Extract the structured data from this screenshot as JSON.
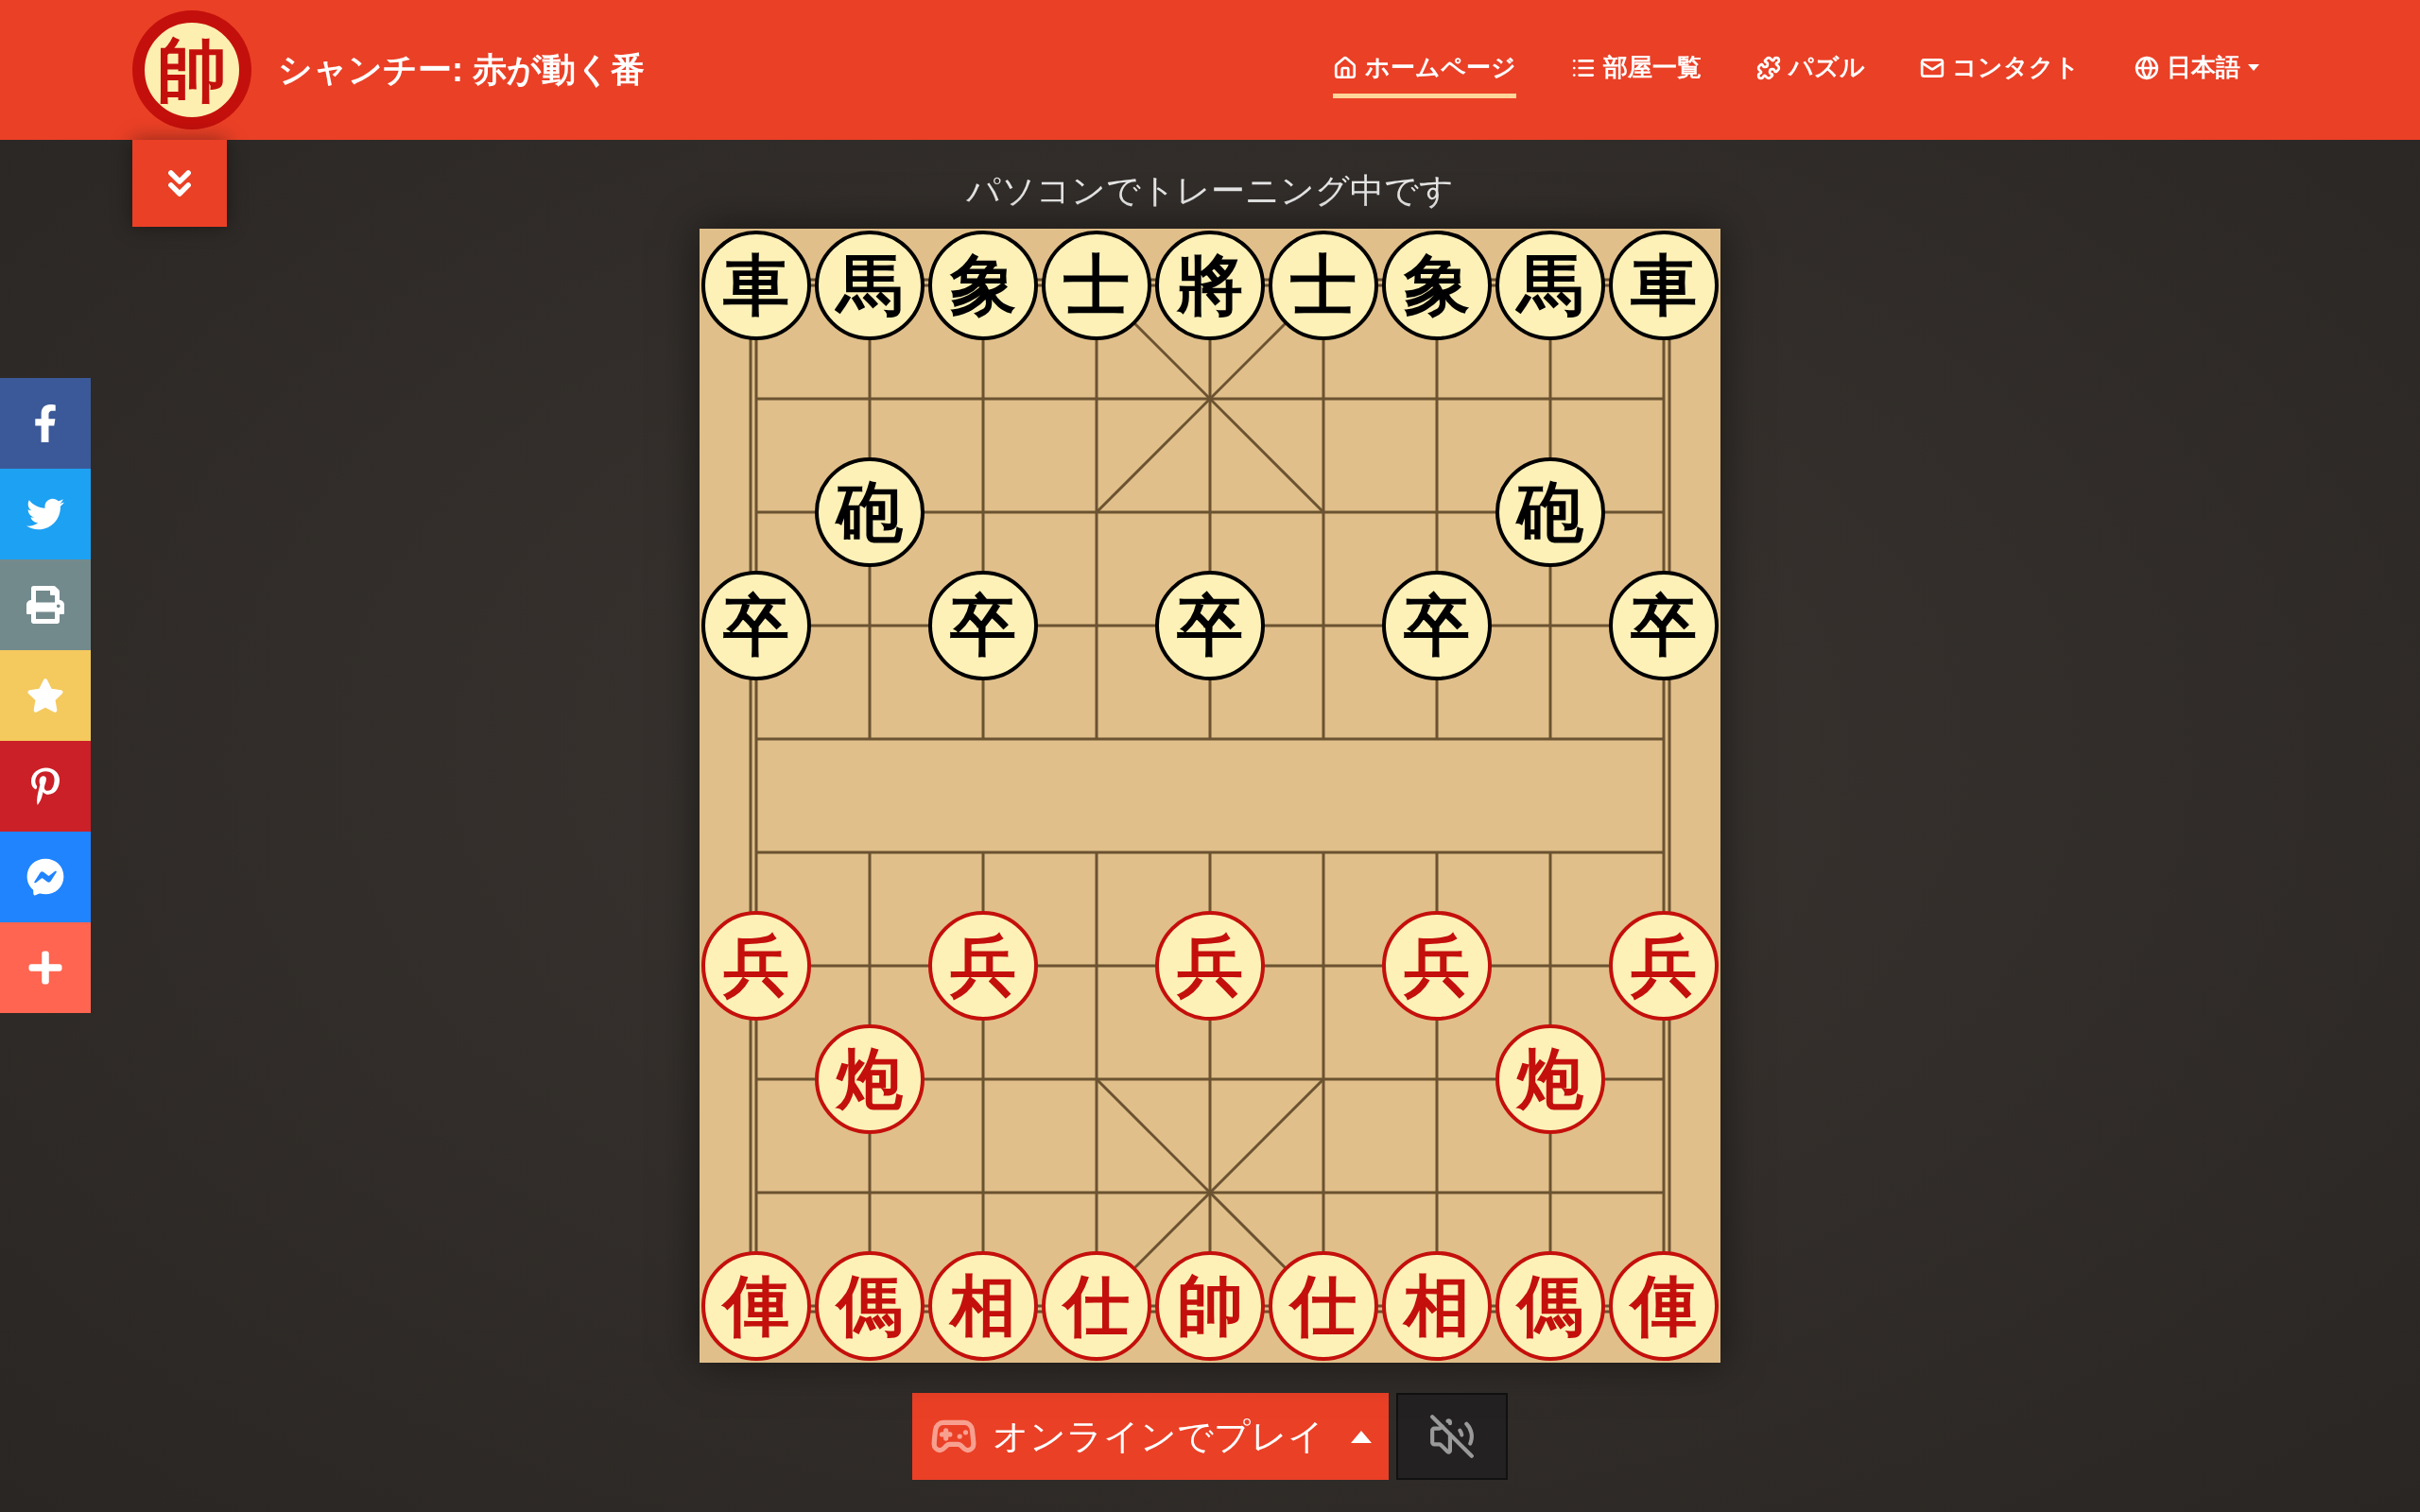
{
  "header": {
    "logo": "帥",
    "title": "シャンチー: 赤が動く番"
  },
  "nav": [
    {
      "kind": "home",
      "label": "ホームページ",
      "selected": true
    },
    {
      "kind": "list",
      "label": "部屋一覧",
      "selected": false
    },
    {
      "kind": "puzzle",
      "label": "パズル",
      "selected": false
    },
    {
      "kind": "mail",
      "label": "コンタクト",
      "selected": false
    },
    {
      "kind": "language",
      "label": "日本語",
      "selected": false
    }
  ],
  "social": [
    {
      "kind": "facebook",
      "color": "#3b5998"
    },
    {
      "kind": "twitter",
      "color": "#1da1f2"
    },
    {
      "kind": "print",
      "color": "#738a8d"
    },
    {
      "kind": "favorite",
      "color": "#f4c95d"
    },
    {
      "kind": "pinterest",
      "color": "#cb2027"
    },
    {
      "kind": "messenger",
      "color": "#2084ff"
    },
    {
      "kind": "more",
      "color": "#ff6550"
    }
  ],
  "status": "パソコンでトレーニング中です",
  "board": {
    "ranks": [
      {
        "points": [
          {
            "kind": "black",
            "char": "車"
          },
          {
            "kind": "black",
            "char": "馬"
          },
          {
            "kind": "black",
            "char": "象"
          },
          {
            "kind": "black",
            "char": "士"
          },
          {
            "kind": "black",
            "char": "將"
          },
          {
            "kind": "black",
            "char": "士"
          },
          {
            "kind": "black",
            "char": "象"
          },
          {
            "kind": "black",
            "char": "馬"
          },
          {
            "kind": "black",
            "char": "車"
          }
        ]
      },
      {
        "points": [
          {
            "kind": "empty"
          },
          {
            "kind": "empty"
          },
          {
            "kind": "empty"
          },
          {
            "kind": "empty"
          },
          {
            "kind": "empty"
          },
          {
            "kind": "empty"
          },
          {
            "kind": "empty"
          },
          {
            "kind": "empty"
          },
          {
            "kind": "empty"
          }
        ]
      },
      {
        "points": [
          {
            "kind": "empty"
          },
          {
            "kind": "black",
            "char": "砲"
          },
          {
            "kind": "empty"
          },
          {
            "kind": "empty"
          },
          {
            "kind": "empty"
          },
          {
            "kind": "empty"
          },
          {
            "kind": "empty"
          },
          {
            "kind": "black",
            "char": "砲"
          },
          {
            "kind": "empty"
          }
        ]
      },
      {
        "points": [
          {
            "kind": "black",
            "char": "卒"
          },
          {
            "kind": "empty"
          },
          {
            "kind": "black",
            "char": "卒"
          },
          {
            "kind": "empty"
          },
          {
            "kind": "black",
            "char": "卒"
          },
          {
            "kind": "empty"
          },
          {
            "kind": "black",
            "char": "卒"
          },
          {
            "kind": "empty"
          },
          {
            "kind": "black",
            "char": "卒"
          }
        ]
      },
      {
        "points": [
          {
            "kind": "empty"
          },
          {
            "kind": "empty"
          },
          {
            "kind": "empty"
          },
          {
            "kind": "empty"
          },
          {
            "kind": "empty"
          },
          {
            "kind": "empty"
          },
          {
            "kind": "empty"
          },
          {
            "kind": "empty"
          },
          {
            "kind": "empty"
          }
        ]
      },
      {
        "points": [
          {
            "kind": "empty"
          },
          {
            "kind": "empty"
          },
          {
            "kind": "empty"
          },
          {
            "kind": "empty"
          },
          {
            "kind": "empty"
          },
          {
            "kind": "empty"
          },
          {
            "kind": "empty"
          },
          {
            "kind": "empty"
          },
          {
            "kind": "empty"
          }
        ]
      },
      {
        "points": [
          {
            "kind": "red",
            "char": "兵"
          },
          {
            "kind": "empty"
          },
          {
            "kind": "red",
            "char": "兵"
          },
          {
            "kind": "empty"
          },
          {
            "kind": "red",
            "char": "兵"
          },
          {
            "kind": "empty"
          },
          {
            "kind": "red",
            "char": "兵"
          },
          {
            "kind": "empty"
          },
          {
            "kind": "red",
            "char": "兵"
          }
        ]
      },
      {
        "points": [
          {
            "kind": "empty"
          },
          {
            "kind": "red",
            "char": "炮"
          },
          {
            "kind": "empty"
          },
          {
            "kind": "empty"
          },
          {
            "kind": "empty"
          },
          {
            "kind": "empty"
          },
          {
            "kind": "empty"
          },
          {
            "kind": "red",
            "char": "炮"
          },
          {
            "kind": "empty"
          }
        ]
      },
      {
        "points": [
          {
            "kind": "empty"
          },
          {
            "kind": "empty"
          },
          {
            "kind": "empty"
          },
          {
            "kind": "empty"
          },
          {
            "kind": "empty"
          },
          {
            "kind": "empty"
          },
          {
            "kind": "empty"
          },
          {
            "kind": "empty"
          },
          {
            "kind": "empty"
          }
        ]
      },
      {
        "points": [
          {
            "kind": "red",
            "char": "俥"
          },
          {
            "kind": "red",
            "char": "傌"
          },
          {
            "kind": "red",
            "char": "相"
          },
          {
            "kind": "red",
            "char": "仕"
          },
          {
            "kind": "red",
            "char": "帥"
          },
          {
            "kind": "red",
            "char": "仕"
          },
          {
            "kind": "red",
            "char": "相"
          },
          {
            "kind": "red",
            "char": "傌"
          },
          {
            "kind": "red",
            "char": "俥"
          }
        ]
      }
    ]
  },
  "play_button": {
    "label": "オンラインでプレイ"
  },
  "sound": {
    "muted": true
  }
}
